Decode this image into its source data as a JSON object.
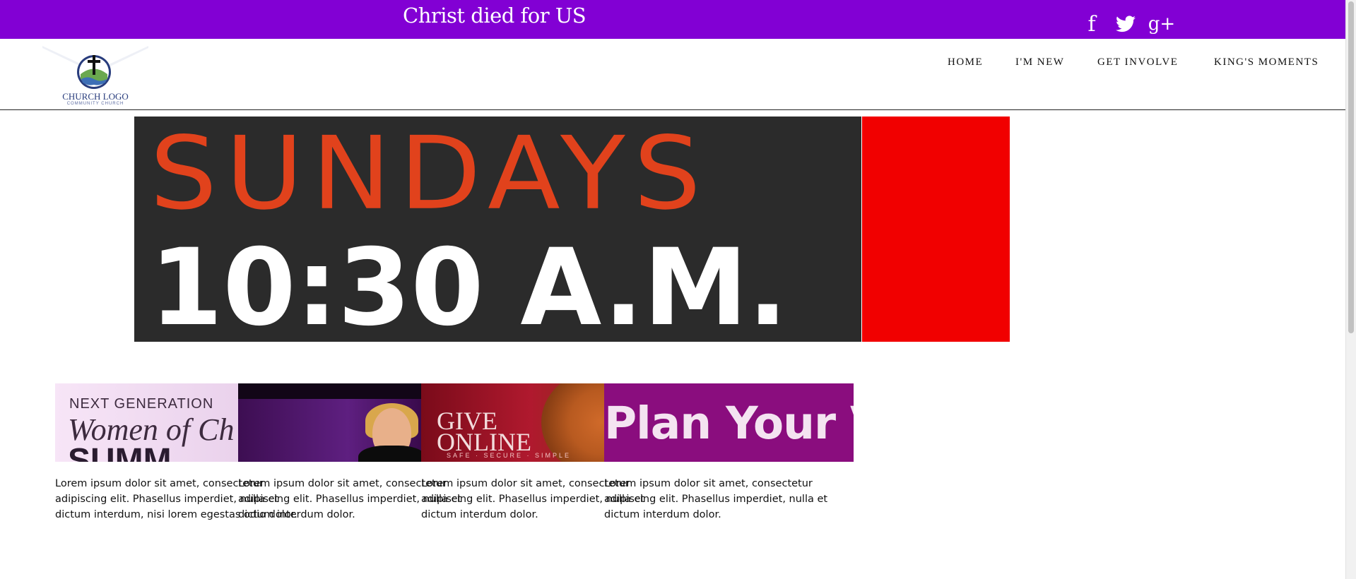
{
  "topbar": {
    "tagline": "Christ died for US",
    "background": "#8200d4",
    "social": [
      {
        "icon": "facebook-icon",
        "glyph": "f"
      },
      {
        "icon": "twitter-icon",
        "glyph": ""
      },
      {
        "icon": "google-plus-icon",
        "glyph": "g+"
      }
    ]
  },
  "header": {
    "logo": {
      "title": "CHURCH LOGO",
      "subtitle": "COMMUNITY CHURCH"
    },
    "nav": [
      "HOME",
      "I'M NEW",
      "GET INVOLVE",
      "KING'S MOMENTS"
    ]
  },
  "hero": {
    "line1": "SUNDAYS",
    "line2": "10:30 A.M.",
    "accent": "#e1421c",
    "side_color": "#f10000"
  },
  "cards": [
    {
      "image_lines": [
        "NEXT GENERATION",
        "Women of Ch",
        "SUMM"
      ],
      "text": "Lorem ipsum dolor sit amet, consectetur adipiscing elit. Phasellus imperdiet, nulla et dictum interdum, nisi lorem egestas odio dolor."
    },
    {
      "image_lines": [],
      "text": "Lorem ipsum dolor sit amet, consectetur adipiscing elit. Phasellus imperdiet, nulla et dictum interdum dolor."
    },
    {
      "image_lines": [
        "GIVE",
        "ONLINE",
        "SAFE · SECURE · SIMPLE"
      ],
      "text": "Lorem ipsum dolor sit amet, consectetur adipiscing elit. Phasellus imperdiet, nulla et dictum interdum dolor."
    },
    {
      "image_lines": [
        "Plan Your Visit"
      ],
      "text": "Lorem ipsum dolor sit amet, consectetur adipiscing elit. Phasellus imperdiet, nulla et dictum interdum dolor."
    }
  ]
}
